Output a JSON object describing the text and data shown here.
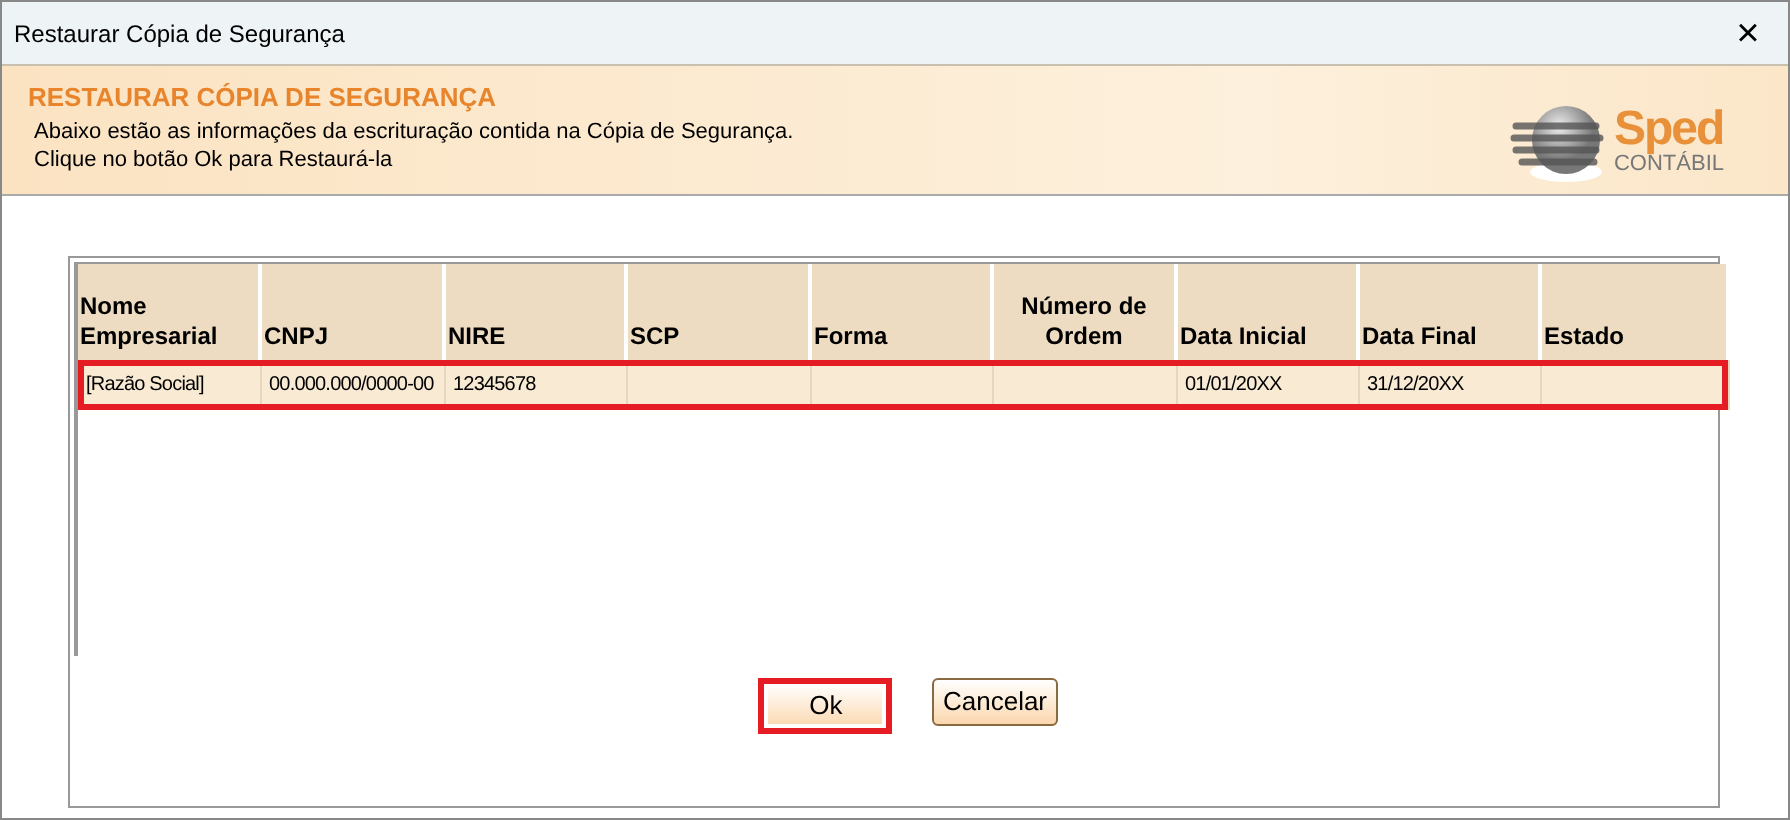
{
  "window": {
    "title": "Restaurar Cópia de Segurança",
    "close": "×"
  },
  "header": {
    "title": "RESTAURAR CÓPIA DE SEGURANÇA",
    "lines": [
      "Abaixo estão as informações da escrituração contida na Cópia de Segurança.",
      "Clique no botão Ok para Restaurá-la"
    ],
    "logo": {
      "name": "Sped",
      "subtitle": "CONTÁBIL"
    }
  },
  "table": {
    "columns": [
      "Nome Empresarial",
      "CNPJ",
      "NIRE",
      "SCP",
      "Forma",
      "Número de Ordem",
      "Data Inicial",
      "Data Final",
      "Estado"
    ],
    "rows": [
      {
        "selected": true,
        "highlighted": true,
        "cells": [
          "[Razão Social]",
          "00.000.000/0000-00",
          "12345678",
          "",
          "",
          "",
          "01/01/20XX",
          "31/12/20XX",
          ""
        ]
      }
    ]
  },
  "buttons": [
    {
      "label": "Ok",
      "highlighted": true
    },
    {
      "label": "Cancelar",
      "highlighted": false
    }
  ]
}
